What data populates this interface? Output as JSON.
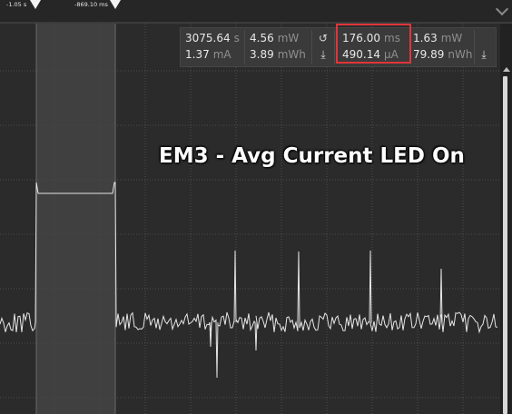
{
  "timeline": {
    "marker_a_label": "-1.05 s",
    "marker_b_label": "-869.10 ms"
  },
  "annotation": "EM3 - Avg Current LED On",
  "measurements": {
    "group1": {
      "time": {
        "value": "3075.64",
        "unit": "s"
      },
      "current": {
        "value": "1.37",
        "unit": "mA"
      },
      "power": {
        "value": "4.56",
        "unit": "mW"
      },
      "energy": {
        "value": "3.89",
        "unit": "mWh"
      }
    },
    "group2": {
      "time": {
        "value": "176.00",
        "unit": "ms"
      },
      "current": {
        "value": "490.14",
        "unit": "µA"
      },
      "power": {
        "value": "1.63",
        "unit": "mW"
      },
      "energy": {
        "value": "79.89",
        "unit": "nWh"
      }
    },
    "icons": {
      "reset": "reset-icon",
      "export": "export-icon"
    }
  },
  "colors": {
    "background": "#2b2b2b",
    "trace": "#e6e6e6",
    "selection": "#4a4a4a",
    "highlight": "#e0353b"
  }
}
